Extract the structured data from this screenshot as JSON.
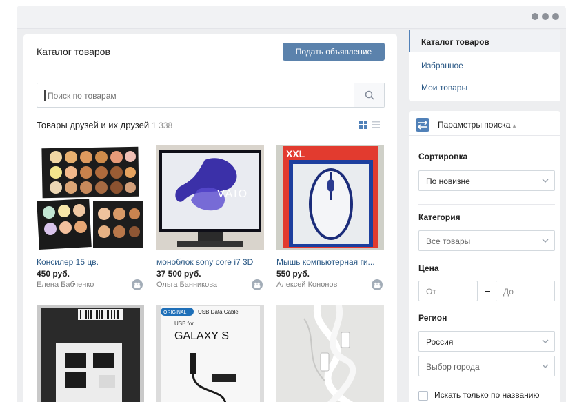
{
  "header": {
    "title": "Каталог товаров",
    "post_button": "Подать объявление"
  },
  "search": {
    "placeholder": "Поиск по товарам"
  },
  "section": {
    "title": "Товары друзей и их друзей",
    "count": "1 338"
  },
  "products": [
    {
      "name": "Консилер 15 цв.",
      "price": "450 руб.",
      "seller": "Елена Бабченко"
    },
    {
      "name": "моноблок sony core i7 3D",
      "price": "37 500 руб.",
      "seller": "Ольга Банникова"
    },
    {
      "name": "Мышь компьютерная ги...",
      "price": "550 руб.",
      "seller": "Алексей Кононов"
    },
    {
      "name": "",
      "price": "",
      "seller": ""
    },
    {
      "name": "",
      "price": "",
      "seller": ""
    },
    {
      "name": "",
      "price": "",
      "seller": ""
    }
  ],
  "photo_text": {
    "vaio": "VAIO",
    "xxl": "XXL",
    "galaxy_top": "ORIGINAL",
    "galaxy_cable": "USB Data Cable",
    "galaxy_for": "USB for",
    "galaxy_name": "GALAXY S"
  },
  "nav": {
    "items": [
      "Каталог товаров",
      "Избранное",
      "Мои товары"
    ]
  },
  "params": {
    "title": "Параметры поиска",
    "sort_label": "Сортировка",
    "sort_value": "По новизне",
    "category_label": "Категория",
    "category_value": "Все товары",
    "price_label": "Цена",
    "price_from": "От",
    "price_to": "До",
    "region_label": "Регион",
    "region_value": "Россия",
    "city_placeholder": "Выбор города",
    "name_only": "Искать только по названию"
  },
  "colors": {
    "accent": "#5181b8",
    "button": "#5b82ac",
    "link": "#2a5885",
    "muted": "#828282"
  }
}
